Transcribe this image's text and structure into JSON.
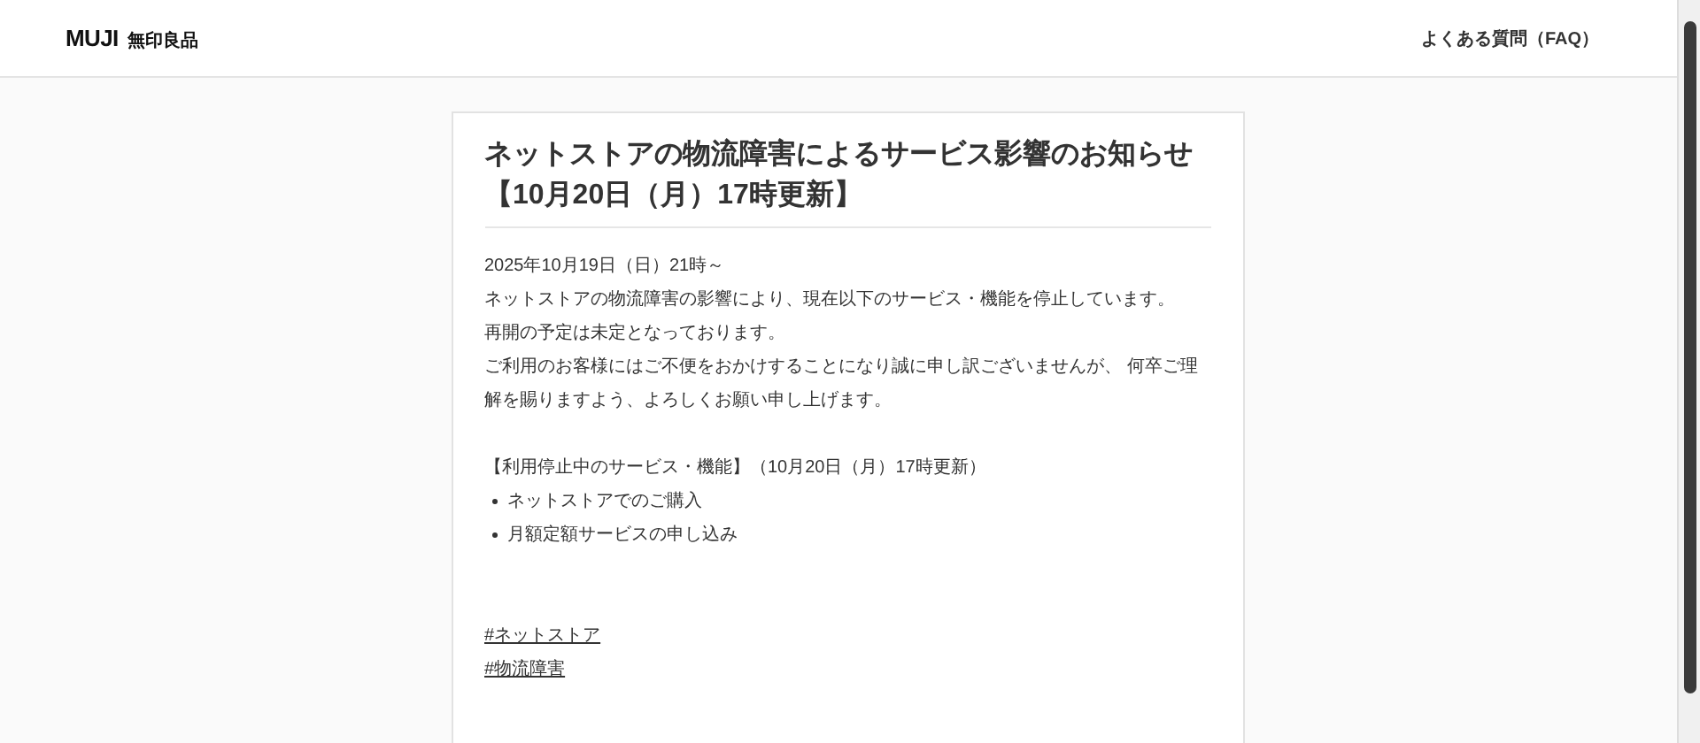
{
  "header": {
    "logo": {
      "wordmark": "MUJI",
      "name": "無印良品"
    },
    "faq_link": "よくある質問（FAQ）"
  },
  "article": {
    "title": "ネットストアの物流障害によるサービス影響のお知らせ【10月20日（月）17時更新】",
    "date": "2025年10月19日（日）21時～",
    "paragraphs": [
      "ネットストアの物流障害の影響により、現在以下のサービス・機能を停止しています。",
      "再開の予定は未定となっております。",
      "ご利用のお客様にはご不便をおかけすることになり誠に申し訳ございませんが、 何卒ご理解を賜りますよう、よろしくお願い申し上げます。"
    ],
    "section_heading": "【利用停止中のサービス・機能】（10月20日（月）17時更新）",
    "list_items": [
      "ネットストアでのご購入",
      "月額定額サービスの申し込み"
    ],
    "tags": [
      "#ネットストア",
      "#物流障害"
    ]
  }
}
